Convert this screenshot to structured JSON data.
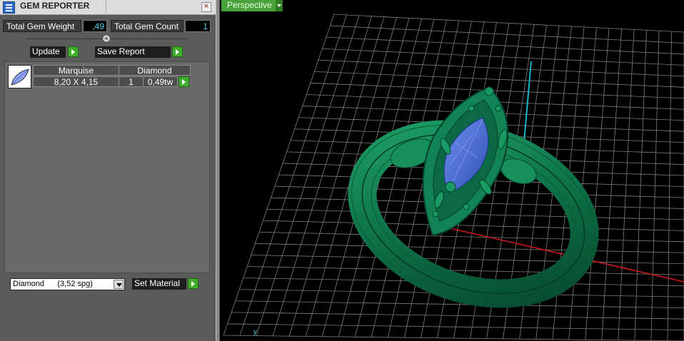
{
  "window": {
    "title": "GEM REPORTER",
    "close_symbol": "×"
  },
  "stats": {
    "total_weight_label": "Total Gem Weight",
    "total_weight_value": ",49",
    "total_count_label": "Total Gem Count",
    "total_count_value": "1"
  },
  "actions": {
    "update_label": "Update",
    "save_report_label": "Save Report"
  },
  "gem_table": {
    "rows": [
      {
        "shape": "Marquise",
        "material": "Diamond",
        "size": "8,20 X 4,15",
        "count": "1",
        "weight": "0,49tw"
      }
    ]
  },
  "material": {
    "selected": "Diamond      (3,52 spg)",
    "set_label": "Set Material"
  },
  "viewport": {
    "view_name": "Perspective",
    "axis_label": "y"
  },
  "colors": {
    "panel_bg": "#5b5b5b",
    "value_text": "#4fd0e6",
    "button_green": "#3fae2a",
    "ring_green": "#0f7a4f",
    "gem_blue": "#3f63c8",
    "grid_line": "#8c8c8c",
    "axis_red": "#d41a1a",
    "axis_cyan": "#19b7c8"
  },
  "icons": [
    "gem-reporter-app-icon",
    "close-icon",
    "play-arrow-icon",
    "dropdown-caret-icon",
    "marquise-gem-icon"
  ]
}
